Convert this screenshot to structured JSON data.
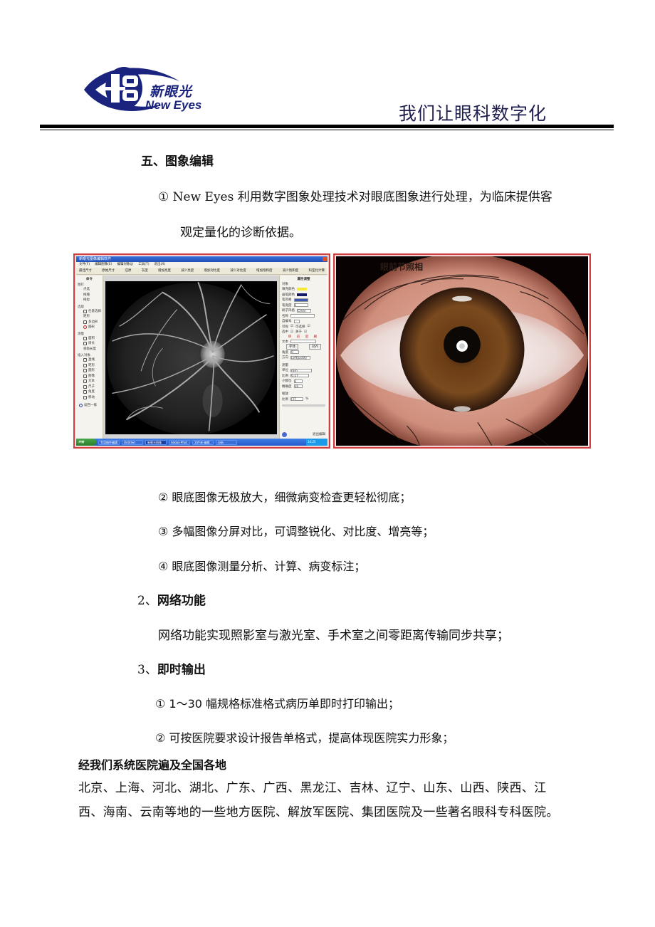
{
  "header": {
    "logo_cn": "新眼光",
    "logo_en": "New Eyes",
    "slogan": "我们让眼科数字化"
  },
  "section5": {
    "title": "五、图象编辑",
    "item1_line1": "① New Eyes 利用数字图象处理技术对眼底图象进行处理，为临床提供客",
    "item1_line2": "观定量化的诊断依据。"
  },
  "figure_app": {
    "window_title": "新眼光图像编辑软件",
    "menu": [
      "文件(F)",
      "编辑图像(E)",
      "编辑对象(J)",
      "工具(T)",
      "退出(X)"
    ],
    "toolbar": [
      "最佳尺寸",
      "原始尺寸",
      "还原",
      "灰度",
      "增加亮度",
      "减少亮度",
      "增加对比度",
      "减少对比度",
      "增加饱和度",
      "减少饱和度",
      "科室比计算"
    ],
    "left_panel": {
      "header": "命令",
      "groups": [
        {
          "label": "图钉",
          "items": [
            "点选",
            "拖拽",
            "拖拉"
          ]
        },
        {
          "label": "选取",
          "items": [
            "任意选择",
            "矩形",
            "多边形",
            "圆形"
          ]
        },
        {
          "label": "测量",
          "items": [
            "面积",
            "周长",
            "视角长度"
          ]
        },
        {
          "label": "插入对象",
          "items": [
            "直线",
            "矩形",
            "圆形",
            "图像",
            "文本",
            "尺子",
            "角度",
            "移动"
          ]
        }
      ],
      "bottom_button": "返回一排"
    },
    "right_panel": {
      "header": "属性调整",
      "object_label": "对象",
      "fill_color_label": "填充颜色",
      "fill_color": "#f5e93a",
      "border_color_label": "画笔颜色",
      "border_color": "#141a6a",
      "line_style_label": "笔风格",
      "line_width_label": "笔宽度",
      "line_width_value": "1",
      "brush_label": "刷子风格",
      "brush_value": "Clear",
      "name_label": "名称",
      "number_label": "自编号",
      "check_labels": [
        "可视",
        "可选择",
        "选中",
        "关于"
      ],
      "action_buttons": "移 前 后 删",
      "text_label": "文本",
      "buttons": [
        "字体",
        "对齐"
      ],
      "angle_label": "角度",
      "angle_value": "0",
      "align_label": "方向",
      "align_value": "LeftJustify",
      "measure_header": "测量",
      "unit_label": "单位",
      "unit_value": "mm",
      "scale_label": "比例",
      "scale_value": "0.17",
      "decimal_label": "小数位",
      "decimal_value": "2",
      "precision_label": "精确度",
      "precision_value": "10",
      "zoom_header": "缩放",
      "zoom_label": "比例",
      "zoom_value": "FIT",
      "zoom_unit": "%",
      "exit_button": "退出编辑"
    },
    "taskbar": {
      "start": "开始",
      "items": [
        "专用图件编辑",
        "Untitled",
        "新眼光图像",
        "Adobe Phot",
        "文件夹-编辑",
        "分析"
      ],
      "active_index": 2,
      "clock": "10:25"
    }
  },
  "figure_eye": {
    "label": "眼前节照相"
  },
  "list_items": {
    "item2": "② 眼底图像无极放大，细微病变检查更轻松彻底；",
    "item3": "③ 多幅图像分屏对比，可调整锐化、对比度、增亮等；",
    "item4": "④ 眼底图像测量分析、计算、病变标注；"
  },
  "section_network": {
    "title_num": "2、",
    "title": "网络功能",
    "body": "网络功能实现照影室与激光室、手术室之间零距离传输同步共享；"
  },
  "section_output": {
    "title_num": "3、",
    "title": "即时输出",
    "item1": "① 1～30 幅规格标准格式病历单即时打印输出；",
    "item2": "② 可按医院要求设计报告单格式，提高体现医院实力形象；"
  },
  "coverage": {
    "title": "经我们系统医院遍及全国各地",
    "line1": "北京、上海、河北、湖北、广东、广西、黑龙江、吉林、辽宁、山东、山西、陕西、江",
    "line2": "西、海南、云南等地的一些地方医院、解放军医院、集团医院及一些著名眼科专科医院。"
  }
}
